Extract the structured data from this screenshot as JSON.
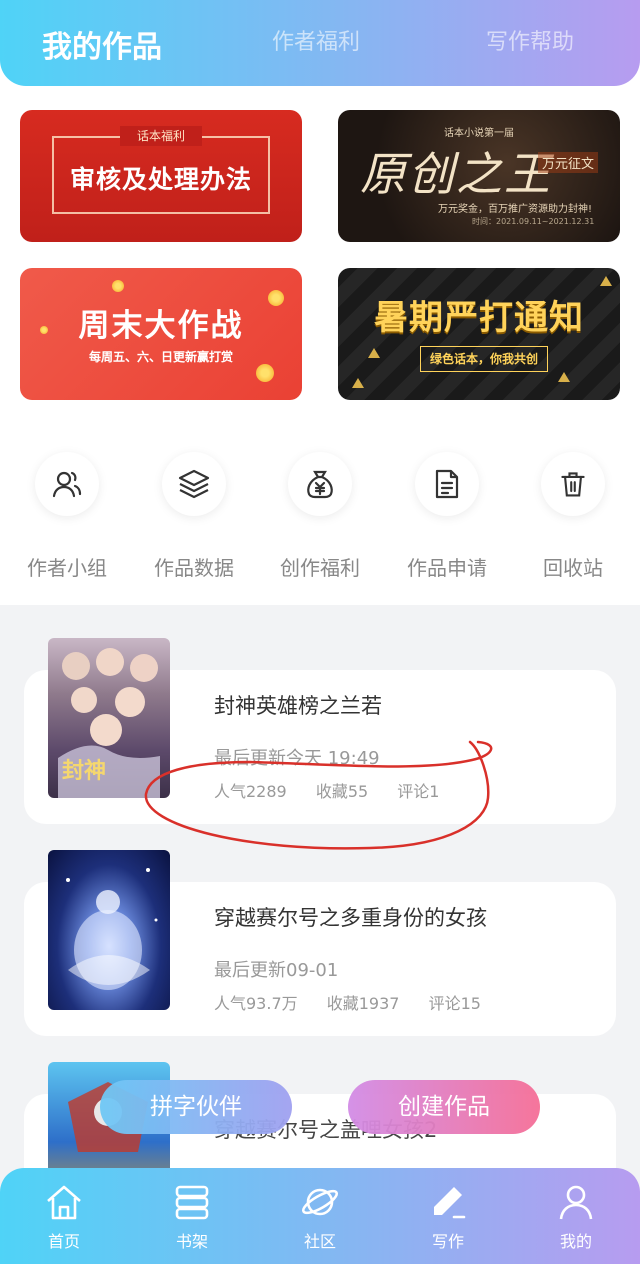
{
  "header": {
    "tabs": [
      {
        "label": "我的作品",
        "active": true
      },
      {
        "label": "作者福利",
        "active": false
      },
      {
        "label": "写作帮助",
        "active": false
      }
    ]
  },
  "banners": [
    {
      "tag": "话本福利",
      "title": "审核及处理办法"
    },
    {
      "top": "话本小说第一届",
      "title": "原创之王",
      "badge": "万元征文",
      "subtitle": "万元奖金，百万推广资源助力封神!",
      "date": "时间：2021.09.11~2021.12.31"
    },
    {
      "title": "周末大作战",
      "subtitle": "每周五、六、日更新赢打赏"
    },
    {
      "title": "暑期严打通知",
      "subtitle": "绿色话本，你我共创"
    }
  ],
  "quick_actions": [
    {
      "label": "作者小组",
      "icon": "group-icon"
    },
    {
      "label": "作品数据",
      "icon": "layers-icon"
    },
    {
      "label": "创作福利",
      "icon": "money-bag-icon"
    },
    {
      "label": "作品申请",
      "icon": "document-icon"
    },
    {
      "label": "回收站",
      "icon": "trash-icon"
    }
  ],
  "works": [
    {
      "title": "封神英雄榜之兰若",
      "updated": "最后更新今天 19:49",
      "popularity": "人气2289",
      "favorites": "收藏55",
      "comments": "评论1",
      "cover_text": "封神"
    },
    {
      "title": "穿越赛尔号之多重身份的女孩",
      "updated": "最后更新09-01",
      "popularity": "人气93.7万",
      "favorites": "收藏1937",
      "comments": "评论15"
    },
    {
      "title": "穿越赛尔号之盖哩女孩2"
    }
  ],
  "floating_buttons": {
    "partner": "拼字伙伴",
    "create": "创建作品"
  },
  "bottom_nav": [
    {
      "label": "首页",
      "icon": "home-icon"
    },
    {
      "label": "书架",
      "icon": "bookshelf-icon"
    },
    {
      "label": "社区",
      "icon": "planet-icon"
    },
    {
      "label": "写作",
      "icon": "pen-icon",
      "active": true
    },
    {
      "label": "我的",
      "icon": "user-icon"
    }
  ],
  "colors": {
    "header_gradient_start": "#4fd3f7",
    "header_gradient_end": "#b79cf0",
    "annotation_red": "#d9302a"
  }
}
